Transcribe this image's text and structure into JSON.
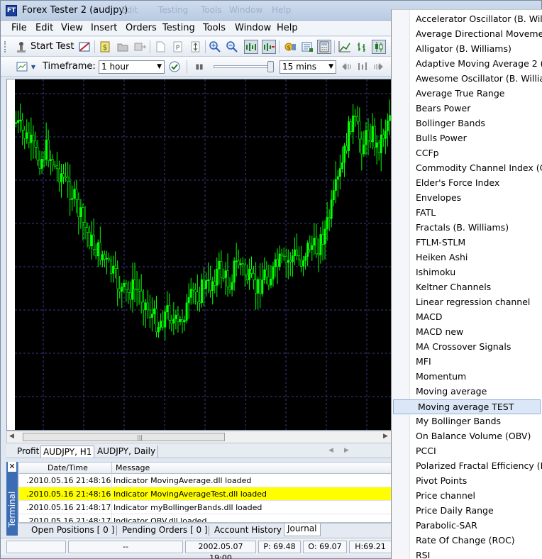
{
  "window": {
    "title": "Forex Tester 2  (audjpy)",
    "app_icon": "FT",
    "ghost_menu": [
      "Edit",
      "Testing",
      "Tools",
      "Window",
      "Help"
    ]
  },
  "menubar": {
    "items": [
      "File",
      "Edit",
      "View",
      "Insert",
      "Orders",
      "Testing",
      "Tools",
      "Window",
      "Help"
    ]
  },
  "toolbar1": {
    "start_test_label": "Start Test"
  },
  "toolbar2": {
    "timeframe_label": "Timeframe:",
    "timeframe_value": "1 hour",
    "speed_value": "15 mins"
  },
  "chart": {
    "background": "#000000",
    "candle_color": "#00ff00",
    "grid_color": "#3a3a8a",
    "price_series": [
      2.5,
      1.5,
      0.5,
      -0.5,
      -2.0,
      -2.5,
      -1.0,
      -2.5,
      -4.0,
      -4.5,
      -6.0,
      -7.0,
      -9.0,
      -11.0,
      -12.5,
      -14.0,
      -15.0,
      -15.5,
      -17.0,
      -18.0,
      -19.5,
      -20.5,
      -21.0,
      -20.0,
      -20.5,
      -21.5,
      -23.0,
      -24.0,
      -25.0,
      -24.0,
      -23.0,
      -24.5,
      -25.5,
      -23.5,
      -22.5,
      -20.5,
      -21.0,
      -19.5,
      -20.0,
      -18.5,
      -17.5,
      -18.5,
      -19.5,
      -17.0,
      -16.5,
      -18.0,
      -19.0,
      -20.5,
      -19.5,
      -18.0,
      -18.5,
      -17.5,
      -16.5,
      -17.0,
      -16.0,
      -15.5,
      -16.5,
      -15.0,
      -14.0,
      -15.0,
      -13.5,
      -12.0,
      -9.5,
      -6.5,
      -4.0,
      -0.5,
      3.0,
      2.0,
      -0.5,
      0.5,
      1.5,
      -1.0,
      0.5,
      2.5,
      5.5
    ]
  },
  "chart_tabs": [
    "Profit",
    "AUDJPY, H1",
    "AUDJPY, Daily"
  ],
  "terminal": {
    "label": "Terminal",
    "columns": [
      "Date/Time",
      "Message"
    ],
    "rows": [
      {
        "date": ".2010.05.16 21:48:16",
        "message": "Indicator MovingAverage.dll loaded"
      },
      {
        "date": ".2010.05.16 21:48:16",
        "message": "Indicator MovingAverageTest.dll loaded"
      },
      {
        "date": ".2010.05.16 21:48:17",
        "message": "Indicator myBollingerBands.dll loaded"
      },
      {
        "date": ".2010.05.16 21:48:17",
        "message": "Indicator OBV.dll loaded"
      }
    ],
    "highlight_color": "#ffff00",
    "tabs": [
      "Open Positions [ 0 ]",
      "Pending Orders [ 0 ]",
      "Account History",
      "Journal"
    ]
  },
  "status": {
    "cell1": "--",
    "datetime": "2002.05.07 19:00",
    "p": "P: 69.48",
    "o": "O: 69.07",
    "h": "H:69.21"
  },
  "indicator_menu": {
    "items": [
      "Accelerator Oscillator (B. Williams)",
      "Average Directional Movement",
      "Alligator (B. Williams)",
      "Adaptive Moving Average 2 (",
      "Awesome Oscillator (B. Williams)",
      "Average True Range",
      "Bears Power",
      "Bollinger Bands",
      "Bulls Power",
      "CCFp",
      "Commodity Channel Index (CCI)",
      "Elder's Force Index",
      "Envelopes",
      "FATL",
      "Fractals (B. Williams)",
      "FTLM-STLM",
      "Heiken Ashi",
      "Ishimoku",
      "Keltner Channels",
      "Linear regression channel",
      "MACD",
      "MACD new",
      "MA Crossover Signals",
      "MFI",
      "Momentum",
      "Moving average",
      "Moving average TEST",
      "My Bollinger Bands",
      "On Balance Volume (OBV)",
      "PCCI",
      "Polarized Fractal Efficiency (PFE)",
      "Pivot Points",
      "Price channel",
      "Price Daily Range",
      "Parabolic-SAR",
      "Rate Of Change (ROC)",
      "RSI"
    ],
    "selected": "Moving average TEST"
  }
}
